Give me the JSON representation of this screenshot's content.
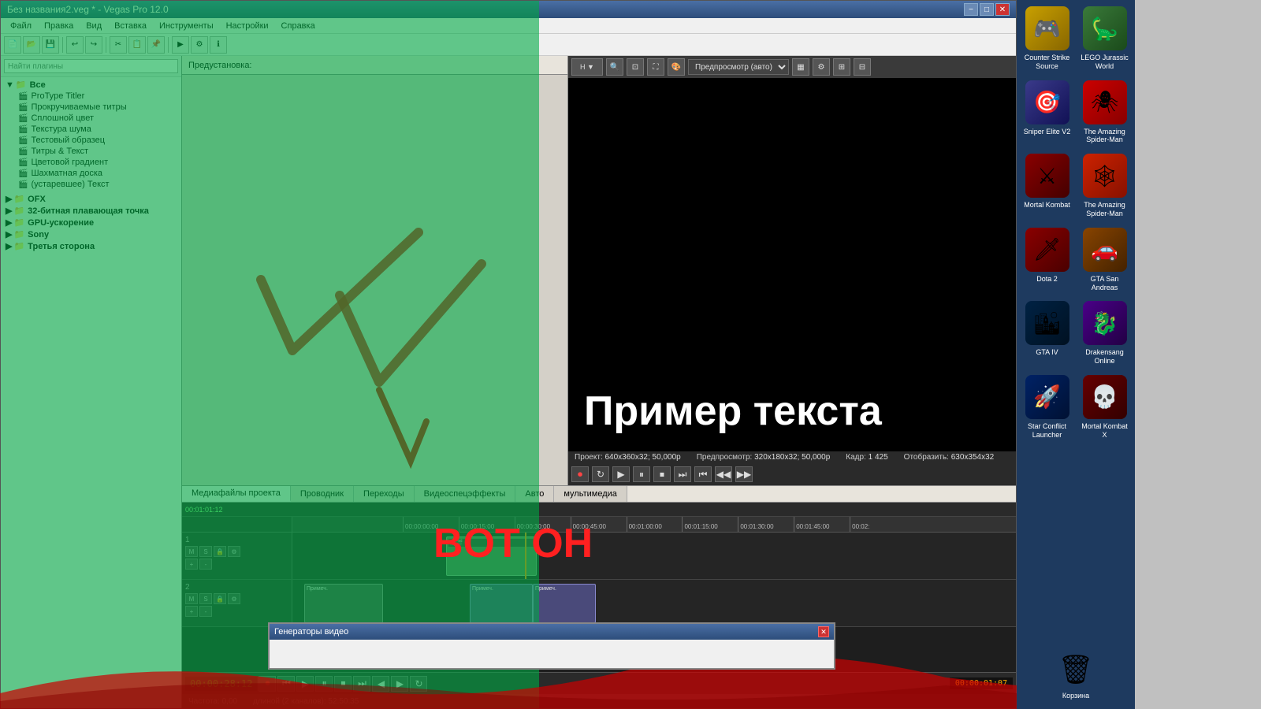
{
  "window": {
    "title": "Без названия2.veg * - Vegas Pro 12.0",
    "min_label": "−",
    "max_label": "□",
    "close_label": "✕"
  },
  "menu": {
    "items": [
      "Файл",
      "Правка",
      "Вид",
      "Вставка",
      "Инструменты",
      "Настройки",
      "Справка"
    ]
  },
  "left_panel": {
    "search_placeholder": "Найти плагины",
    "root_label": "Все",
    "items": [
      "ProType Titler",
      "Прокручиваемые титры",
      "Сплошной цвет",
      "Текстура шума",
      "Тестовый образец",
      "Титры & Текст",
      "Цветовой градиент",
      "Шахматная доска",
      "(устаревшее) Текст"
    ],
    "groups": [
      "OFX",
      "32-битная плавающая точка",
      "GPU-ускорение",
      "Sony",
      "Третья сторона"
    ]
  },
  "preset_panel": {
    "header": "Предустановка:"
  },
  "preview": {
    "label": "Предпросмотр (авто)",
    "text": "Пример текста",
    "project_label": "Проект:",
    "project_value": "640x360x32; 50,000p",
    "preview_label": "Предпросмотр:",
    "preview_value": "320x180x32; 50,000p",
    "frame_label": "Кадр:",
    "frame_value": "1 425",
    "display_label": "Отобразить:",
    "display_value": "630x354x32"
  },
  "timeline": {
    "time_markers": [
      "00:00:00:00",
      "00:00:15:00",
      "00:00:30:00",
      "00:00:45:00",
      "00:01:00:00",
      "00:01:15:00",
      "00:01:30:00",
      "00:01:45:00",
      "00:02:"
    ],
    "time_display": "00:00:28:12",
    "end_time": "00:00:01:07",
    "frequency": "Частота: 0,00",
    "duration": "длиной (2 каналов): 52:50:35"
  },
  "bottom_tabs": [
    "Медиафайлы проекта",
    "Проводник",
    "Переходы",
    "Видеоспецэффекты",
    "Авто",
    "мультимедиа"
  ],
  "overlay_text": "BOT ОН",
  "dialog": {
    "title": "Генераторы видео",
    "close_label": "✕"
  },
  "games": [
    {
      "label": "Counter Strike Source",
      "color": "#c8a000",
      "icon": "🎮"
    },
    {
      "label": "LEGO Jurassic World",
      "color": "#3a7a3a",
      "icon": "🦕"
    },
    {
      "label": "Sniper Elite V2",
      "color": "#3a3a8a",
      "icon": "🎯"
    },
    {
      "label": "The Amazing Spider-Man",
      "color": "#cc0000",
      "icon": "🕷"
    },
    {
      "label": "Mortal Kombat",
      "color": "#8a0000",
      "icon": "⚔"
    },
    {
      "label": "The Amazing Spider-Man",
      "color": "#cc2200",
      "icon": "🕸"
    },
    {
      "label": "Dota 2",
      "color": "#8a0000",
      "icon": "🗡"
    },
    {
      "label": "GTA San Andreas",
      "color": "#884400",
      "icon": "🚗"
    },
    {
      "label": "GTA IV",
      "color": "#002244",
      "icon": "🏙"
    },
    {
      "label": "Drakensang Online",
      "color": "#4a0088",
      "icon": "🐉"
    },
    {
      "label": "Star Conflict Launcher",
      "color": "#002266",
      "icon": "🚀"
    },
    {
      "label": "Mortal Kombat X",
      "color": "#660000",
      "icon": "💀"
    }
  ],
  "trash": {
    "label": "Корзина",
    "icon": "🗑"
  }
}
